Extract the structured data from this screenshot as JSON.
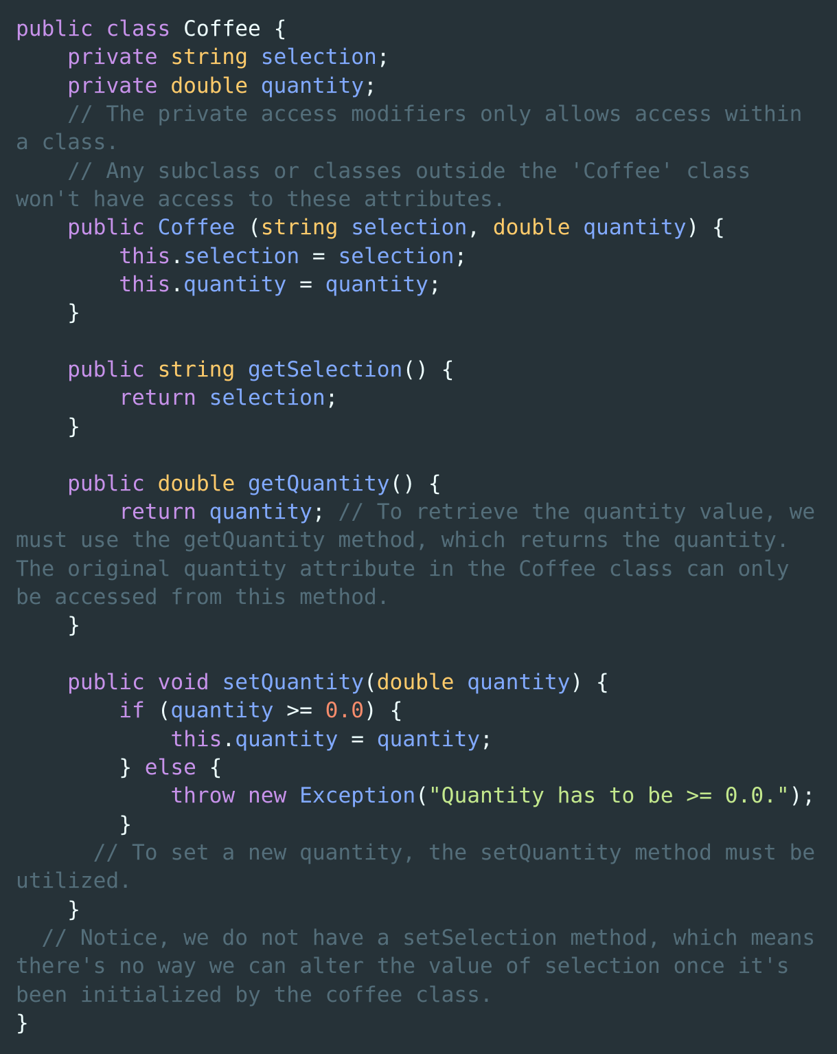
{
  "editor": {
    "language": "java",
    "theme_colors": {
      "background": "#263238",
      "keyword": "#c792ea",
      "type": "#ffcb6b",
      "identifier": "#82aaff",
      "plain": "#eeffff",
      "number": "#f78c6c",
      "string": "#c3e88d",
      "comment": "#546e7a"
    },
    "lines": [
      [
        [
          "kw",
          "public"
        ],
        [
          "pun",
          " "
        ],
        [
          "kw",
          "class"
        ],
        [
          "pun",
          " "
        ],
        [
          "cls",
          "Coffee"
        ],
        [
          "pun",
          " {"
        ]
      ],
      [
        [
          "pun",
          "    "
        ],
        [
          "kw",
          "private"
        ],
        [
          "pun",
          " "
        ],
        [
          "type",
          "string"
        ],
        [
          "pun",
          " "
        ],
        [
          "id",
          "selection"
        ],
        [
          "pun",
          ";"
        ]
      ],
      [
        [
          "pun",
          "    "
        ],
        [
          "kw",
          "private"
        ],
        [
          "pun",
          " "
        ],
        [
          "type",
          "double"
        ],
        [
          "pun",
          " "
        ],
        [
          "id",
          "quantity"
        ],
        [
          "pun",
          ";"
        ]
      ],
      [
        [
          "com",
          "    // The private access modifiers only allows access within"
        ]
      ],
      [
        [
          "com",
          "a class."
        ]
      ],
      [
        [
          "com",
          "    // Any subclass or classes outside the 'Coffee' class"
        ]
      ],
      [
        [
          "com",
          "won't have access to these attributes."
        ]
      ],
      [
        [
          "pun",
          "    "
        ],
        [
          "kw",
          "public"
        ],
        [
          "pun",
          " "
        ],
        [
          "id",
          "Coffee"
        ],
        [
          "pun",
          " ("
        ],
        [
          "type",
          "string"
        ],
        [
          "pun",
          " "
        ],
        [
          "id",
          "selection"
        ],
        [
          "pun",
          ", "
        ],
        [
          "type",
          "double"
        ],
        [
          "pun",
          " "
        ],
        [
          "id",
          "quantity"
        ],
        [
          "pun",
          ") {"
        ]
      ],
      [
        [
          "pun",
          "        "
        ],
        [
          "kw",
          "this"
        ],
        [
          "pun",
          "."
        ],
        [
          "id",
          "selection"
        ],
        [
          "pun",
          " = "
        ],
        [
          "id",
          "selection"
        ],
        [
          "pun",
          ";"
        ]
      ],
      [
        [
          "pun",
          "        "
        ],
        [
          "kw",
          "this"
        ],
        [
          "pun",
          "."
        ],
        [
          "id",
          "quantity"
        ],
        [
          "pun",
          " = "
        ],
        [
          "id",
          "quantity"
        ],
        [
          "pun",
          ";"
        ]
      ],
      [
        [
          "pun",
          "    }"
        ]
      ],
      [],
      [
        [
          "pun",
          "    "
        ],
        [
          "kw",
          "public"
        ],
        [
          "pun",
          " "
        ],
        [
          "type",
          "string"
        ],
        [
          "pun",
          " "
        ],
        [
          "id",
          "getSelection"
        ],
        [
          "pun",
          "() {"
        ]
      ],
      [
        [
          "pun",
          "        "
        ],
        [
          "kw",
          "return"
        ],
        [
          "pun",
          " "
        ],
        [
          "id",
          "selection"
        ],
        [
          "pun",
          ";"
        ]
      ],
      [
        [
          "pun",
          "    }"
        ]
      ],
      [],
      [
        [
          "pun",
          "    "
        ],
        [
          "kw",
          "public"
        ],
        [
          "pun",
          " "
        ],
        [
          "type",
          "double"
        ],
        [
          "pun",
          " "
        ],
        [
          "id",
          "getQuantity"
        ],
        [
          "pun",
          "() {"
        ]
      ],
      [
        [
          "pun",
          "        "
        ],
        [
          "kw",
          "return"
        ],
        [
          "pun",
          " "
        ],
        [
          "id",
          "quantity"
        ],
        [
          "pun",
          "; "
        ],
        [
          "com",
          "// To retrieve the quantity value, we"
        ]
      ],
      [
        [
          "com",
          "must use the getQuantity method, which returns the quantity."
        ]
      ],
      [
        [
          "com",
          "The original quantity attribute in the Coffee class can only"
        ]
      ],
      [
        [
          "com",
          "be accessed from this method."
        ]
      ],
      [
        [
          "pun",
          "    }"
        ]
      ],
      [],
      [
        [
          "pun",
          "    "
        ],
        [
          "kw",
          "public"
        ],
        [
          "pun",
          " "
        ],
        [
          "kw",
          "void"
        ],
        [
          "pun",
          " "
        ],
        [
          "id",
          "setQuantity"
        ],
        [
          "pun",
          "("
        ],
        [
          "type",
          "double"
        ],
        [
          "pun",
          " "
        ],
        [
          "id",
          "quantity"
        ],
        [
          "pun",
          ") {"
        ]
      ],
      [
        [
          "pun",
          "        "
        ],
        [
          "kw",
          "if"
        ],
        [
          "pun",
          " ("
        ],
        [
          "id",
          "quantity"
        ],
        [
          "pun",
          " >= "
        ],
        [
          "num",
          "0.0"
        ],
        [
          "pun",
          ") {"
        ]
      ],
      [
        [
          "pun",
          "            "
        ],
        [
          "kw",
          "this"
        ],
        [
          "pun",
          "."
        ],
        [
          "id",
          "quantity"
        ],
        [
          "pun",
          " = "
        ],
        [
          "id",
          "quantity"
        ],
        [
          "pun",
          ";"
        ]
      ],
      [
        [
          "pun",
          "        } "
        ],
        [
          "kw",
          "else"
        ],
        [
          "pun",
          " {"
        ]
      ],
      [
        [
          "pun",
          "            "
        ],
        [
          "kw",
          "throw"
        ],
        [
          "pun",
          " "
        ],
        [
          "kw",
          "new"
        ],
        [
          "pun",
          " "
        ],
        [
          "id",
          "Exception"
        ],
        [
          "pun",
          "("
        ],
        [
          "str",
          "\"Quantity has to be >= 0.0.\""
        ],
        [
          "pun",
          ");"
        ]
      ],
      [
        [
          "pun",
          "        }"
        ]
      ],
      [
        [
          "com",
          "      // To set a new quantity, the setQuantity method must be"
        ]
      ],
      [
        [
          "com",
          "utilized."
        ]
      ],
      [
        [
          "pun",
          "    }"
        ]
      ],
      [
        [
          "com",
          "  // Notice, we do not have a setSelection method, which means"
        ]
      ],
      [
        [
          "com",
          "there's no way we can alter the value of selection once it's"
        ]
      ],
      [
        [
          "com",
          "been initialized by the coffee class."
        ]
      ],
      [
        [
          "pun",
          "}"
        ]
      ]
    ]
  }
}
